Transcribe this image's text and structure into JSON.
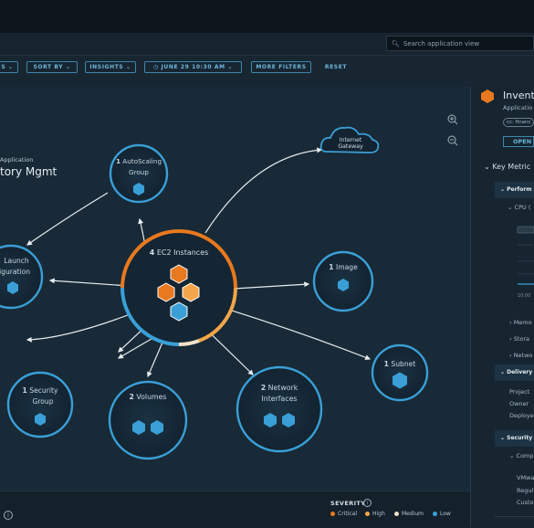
{
  "search": {
    "placeholder": "Search application view"
  },
  "filters": {
    "first_label": "S",
    "sort_label": "SORT BY",
    "insights_label": "INSIGHTS",
    "date_label": "JUNE 29 10:30 AM",
    "more_label": "MORE FILTERS",
    "reset_label": "RESET"
  },
  "app": {
    "kind": "Application",
    "name": "tory Mgmt"
  },
  "nodes": {
    "autoscaling": {
      "count": "1",
      "line1": "AutoScaling",
      "line2": "Group"
    },
    "gateway": {
      "line1": "Internet",
      "line2": "Gateway"
    },
    "launch": {
      "line1": "Launch",
      "line2": "onfiguration"
    },
    "ec2": {
      "count": "4",
      "label": "EC2 Instances"
    },
    "image": {
      "count": "1",
      "label": "Image"
    },
    "subnet": {
      "count": "1",
      "label": "Subnet"
    },
    "security": {
      "count": "1",
      "line1": "Security",
      "line2": "Group"
    },
    "volumes": {
      "count": "2",
      "label": "Volumes"
    },
    "network": {
      "count": "2",
      "line1": "Network",
      "line2": "Interfaces"
    }
  },
  "severity": {
    "title": "SEVERITY",
    "items": [
      {
        "label": "Critical",
        "color": "#e8791e"
      },
      {
        "label": "High",
        "color": "#f4a54a"
      },
      {
        "label": "Medium",
        "color": "#f3e1c7"
      },
      {
        "label": "Low",
        "color": "#3a9fd6"
      }
    ]
  },
  "panel": {
    "title": "Invent",
    "subtitle": "Applicatio",
    "tag": "cc: financ",
    "open_label": "OPEN",
    "key_metrics": "Key Metric",
    "performance": "Perform",
    "cpu": "CPU (",
    "chart_time": "10:00",
    "memory": "Memo",
    "storage": "Stora",
    "network": "Netwo",
    "delivery": "Delivery",
    "project": "Project",
    "owner": "Owner",
    "deployed": "Deploye",
    "security": "Security",
    "compliance": "Comp",
    "vmware": "VMwa",
    "regulatory": "Regul",
    "custom": "Custo"
  }
}
